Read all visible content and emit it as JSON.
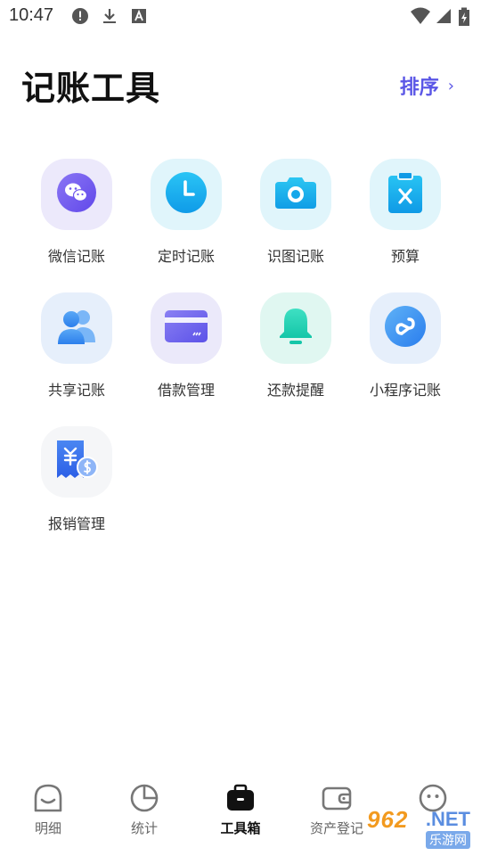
{
  "status_bar": {
    "time": "10:47",
    "icons": [
      "alert-icon",
      "download-icon",
      "font-a-icon",
      "wifi-icon",
      "signal-icon",
      "battery-charging-icon"
    ]
  },
  "header": {
    "title": "记账工具",
    "sort_label": "排序",
    "sort_chevron": "›"
  },
  "tools": [
    {
      "label": "微信记账",
      "icon": "wechat-icon",
      "bg": "#ece9fb",
      "accent": "#7a62f0"
    },
    {
      "label": "定时记账",
      "icon": "clock-icon",
      "bg": "#e0f5fb",
      "accent": "#1bb6f0"
    },
    {
      "label": "识图记账",
      "icon": "camera-icon",
      "bg": "#e0f5fb",
      "accent": "#19b8ec"
    },
    {
      "label": "预算",
      "icon": "clipboard-icon",
      "bg": "#e0f5fb",
      "accent": "#17b1ee"
    },
    {
      "label": "共享记账",
      "icon": "users-icon",
      "bg": "#e6effb",
      "accent": "#3f8ff0"
    },
    {
      "label": "借款管理",
      "icon": "card-icon",
      "bg": "#ebe9fa",
      "accent": "#6c63ec"
    },
    {
      "label": "还款提醒",
      "icon": "bell-icon",
      "bg": "#e0f7f1",
      "accent": "#27d3b7"
    },
    {
      "label": "小程序记账",
      "icon": "mini-program-icon",
      "bg": "#e6effb",
      "accent": "#3a8ff2"
    },
    {
      "label": "报销管理",
      "icon": "receipt-icon",
      "bg": "#f5f6f8",
      "accent": "#3c6ef0"
    }
  ],
  "bottom_nav": {
    "items": [
      {
        "label": "明细",
        "icon": "detail-face-icon",
        "active": false
      },
      {
        "label": "统计",
        "icon": "pie-chart-icon",
        "active": false
      },
      {
        "label": "工具箱",
        "icon": "toolbox-icon",
        "active": true
      },
      {
        "label": "资产登记",
        "icon": "wallet-icon",
        "active": false
      },
      {
        "label": "",
        "icon": "smile-icon",
        "active": false
      }
    ]
  },
  "watermark": {
    "number": "962",
    "net": ".NET",
    "subtitle": "乐游网"
  }
}
